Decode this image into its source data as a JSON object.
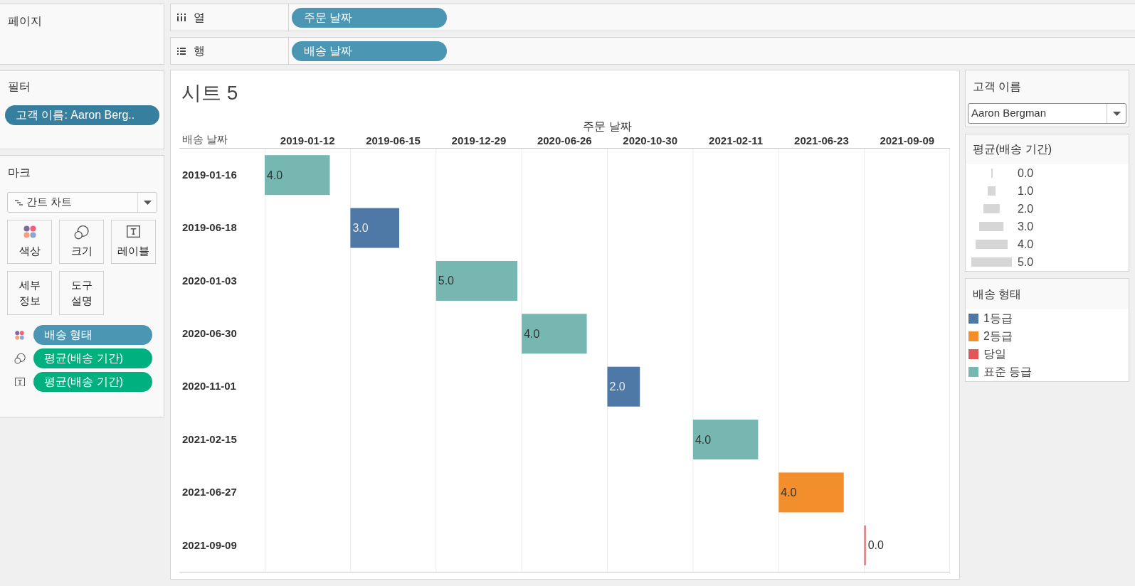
{
  "pages_shelf": {
    "title": "페이지"
  },
  "filters_shelf": {
    "title": "필터",
    "pills": [
      {
        "label": "고객 이름: Aaron Berg.."
      }
    ]
  },
  "marks_card": {
    "title": "마크",
    "mark_type": "간트 차트",
    "buttons": [
      {
        "kind": "color",
        "label": "색상"
      },
      {
        "kind": "size",
        "label": "크기"
      },
      {
        "kind": "label",
        "label": "레이블"
      },
      {
        "kind": "detail",
        "label": "세부 정보"
      },
      {
        "kind": "tooltip",
        "label": "도구 설명"
      }
    ],
    "fields": [
      {
        "kind": "color",
        "label": "배송 형태",
        "color": "#4a96b3"
      },
      {
        "kind": "size",
        "label": "평균(배송 기간)",
        "color": "#00b17f"
      },
      {
        "kind": "label",
        "label": "평균(배송 기간)",
        "color": "#00b17f"
      }
    ]
  },
  "columns_shelf": {
    "label": "열",
    "pills": [
      {
        "label": "주문 날짜"
      }
    ]
  },
  "rows_shelf": {
    "label": "행",
    "pills": [
      {
        "label": "배송 날짜"
      }
    ]
  },
  "sheet": {
    "title": "시트 5",
    "chart_data": {
      "type": "other",
      "xlabel": "주문 날짜",
      "ylabel": "배송 날짜",
      "categories": [
        "2019-01-12",
        "2019-06-15",
        "2019-12-29",
        "2020-06-26",
        "2020-10-30",
        "2021-02-11",
        "2021-06-23",
        "2021-09-09"
      ],
      "y_categories": [
        "2019-01-16",
        "2019-06-18",
        "2020-01-03",
        "2020-06-30",
        "2020-11-01",
        "2021-02-15",
        "2021-06-27",
        "2021-09-09"
      ],
      "values": [
        4,
        3,
        5,
        4,
        2,
        4,
        4,
        0
      ],
      "colors": [
        "#76b7b2",
        "#4e79a7",
        "#76b7b2",
        "#76b7b2",
        "#4e79a7",
        "#76b7b2",
        "#f28e2b",
        "#e15759"
      ],
      "value_labels": [
        "4.0",
        "3.0",
        "5.0",
        "4.0",
        "2.0",
        "4.0",
        "4.0",
        "0.0"
      ]
    }
  },
  "customer_filter": {
    "title": "고객 이름",
    "value": "Aaron Bergman"
  },
  "size_legend": {
    "title": "평균(배송 기간)",
    "items": [
      {
        "label": "0.0"
      },
      {
        "label": "1.0"
      },
      {
        "label": "2.0"
      },
      {
        "label": "3.0"
      },
      {
        "label": "4.0"
      },
      {
        "label": "5.0"
      }
    ]
  },
  "color_legend": {
    "title": "배송 형태",
    "items": [
      {
        "label": "1등급",
        "color": "#4e79a7"
      },
      {
        "label": "2등급",
        "color": "#f28e2b"
      },
      {
        "label": "당일",
        "color": "#e15759"
      },
      {
        "label": "표준 등급",
        "color": "#76b7b2"
      }
    ]
  }
}
